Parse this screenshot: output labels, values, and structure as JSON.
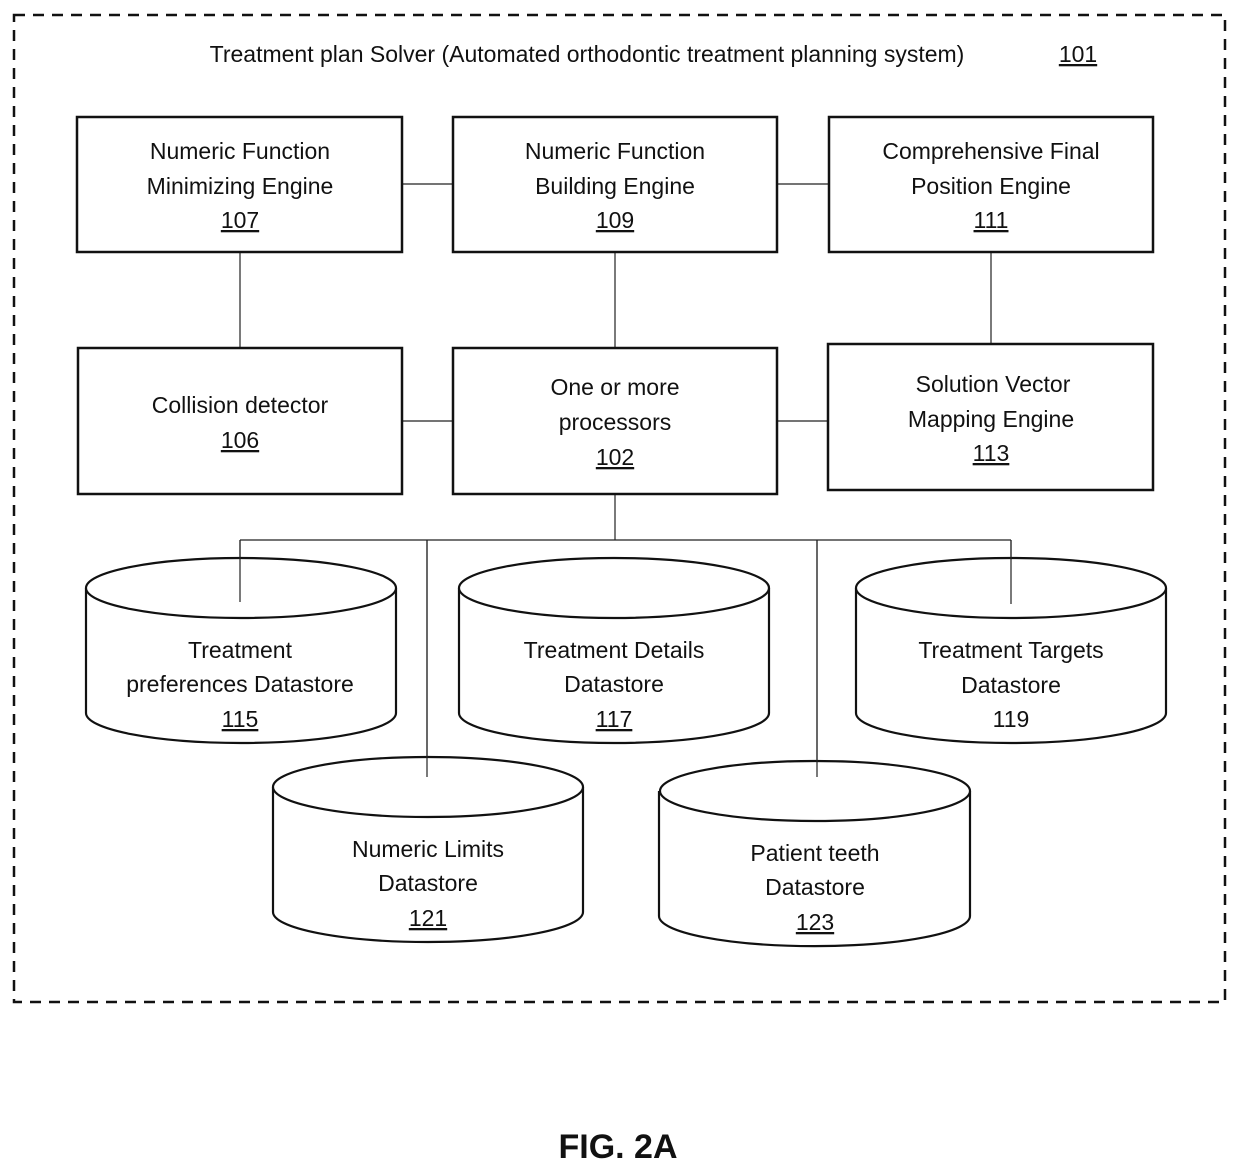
{
  "diagram": {
    "title": "Treatment plan Solver (Automated orthodontic treatment planning system)",
    "title_ref": "101",
    "figure_label": "FIG. 2A",
    "components": {
      "minimizing_engine": {
        "lines": [
          "Numeric Function",
          "Minimizing Engine"
        ],
        "ref": "107",
        "ref_underlined": true
      },
      "building_engine": {
        "lines": [
          "Numeric Function",
          "Building Engine"
        ],
        "ref": "109",
        "ref_underlined": true
      },
      "final_position_engine": {
        "lines": [
          "Comprehensive Final",
          "Position Engine"
        ],
        "ref": "111",
        "ref_underlined": true
      },
      "collision_detector": {
        "lines": [
          "Collision detector"
        ],
        "ref": "106",
        "ref_underlined": true
      },
      "processors": {
        "lines": [
          "One or more",
          "processors"
        ],
        "ref": "102",
        "ref_underlined": true
      },
      "solution_vector_engine": {
        "lines": [
          "Solution Vector",
          "Mapping Engine"
        ],
        "ref": "113",
        "ref_underlined": true
      }
    },
    "datastores": {
      "treatment_preferences": {
        "lines": [
          "Treatment",
          "preferences Datastore"
        ],
        "ref": "115",
        "ref_underlined": true
      },
      "treatment_details": {
        "lines": [
          "Treatment Details",
          "Datastore"
        ],
        "ref": "117",
        "ref_underlined": true
      },
      "treatment_targets": {
        "lines": [
          "Treatment Targets",
          "Datastore"
        ],
        "ref": "119",
        "ref_underlined": false
      },
      "numeric_limits": {
        "lines": [
          "Numeric Limits",
          "Datastore"
        ],
        "ref": "121",
        "ref_underlined": true
      },
      "patient_teeth": {
        "lines": [
          "Patient teeth",
          "Datastore"
        ],
        "ref": "123",
        "ref_underlined": true
      }
    },
    "connections": [
      [
        "minimizing_engine",
        "building_engine"
      ],
      [
        "building_engine",
        "final_position_engine"
      ],
      [
        "minimizing_engine",
        "collision_detector"
      ],
      [
        "building_engine",
        "processors"
      ],
      [
        "final_position_engine",
        "solution_vector_engine"
      ],
      [
        "collision_detector",
        "processors"
      ],
      [
        "processors",
        "solution_vector_engine"
      ],
      [
        "processors",
        "treatment_preferences"
      ],
      [
        "processors",
        "numeric_limits"
      ],
      [
        "processors",
        "treatment_details"
      ],
      [
        "processors",
        "patient_teeth"
      ],
      [
        "processors",
        "treatment_targets"
      ]
    ]
  }
}
